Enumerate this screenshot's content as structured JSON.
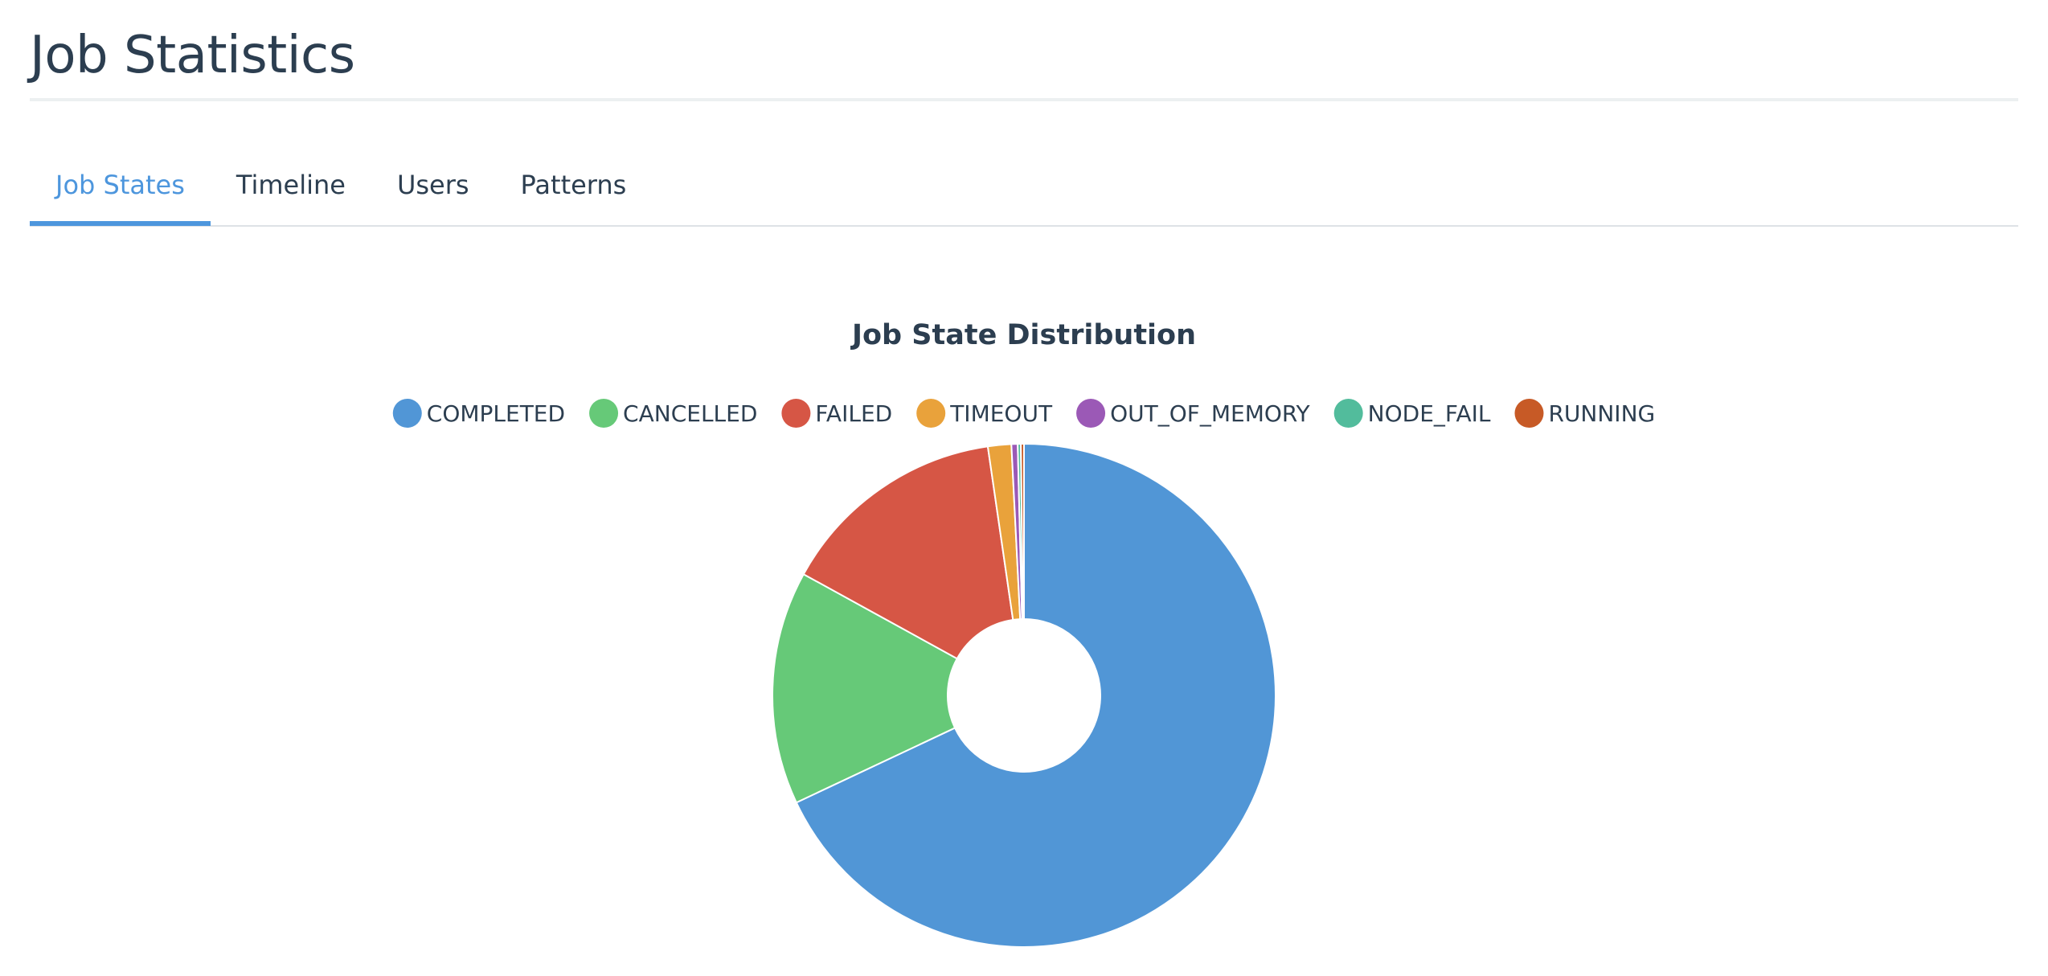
{
  "header": {
    "title": "Job Statistics"
  },
  "tabs": [
    {
      "label": "Job States",
      "active": true
    },
    {
      "label": "Timeline",
      "active": false
    },
    {
      "label": "Users",
      "active": false
    },
    {
      "label": "Patterns",
      "active": false
    }
  ],
  "colors": {
    "accent": "#4d96dd",
    "text": "#2c3e50"
  },
  "chart_data": {
    "type": "pie",
    "style": "donut",
    "title": "Job State Distribution",
    "legend_position": "top",
    "categories": [
      "COMPLETED",
      "CANCELLED",
      "FAILED",
      "TIMEOUT",
      "OUT_OF_MEMORY",
      "NODE_FAIL",
      "RUNNING"
    ],
    "values": [
      68.0,
      15.0,
      14.7,
      1.5,
      0.4,
      0.2,
      0.2
    ],
    "colors": [
      "#5196d6",
      "#66c978",
      "#d65645",
      "#e9a23b",
      "#9b59b6",
      "#52bc9c",
      "#c75a26"
    ]
  }
}
